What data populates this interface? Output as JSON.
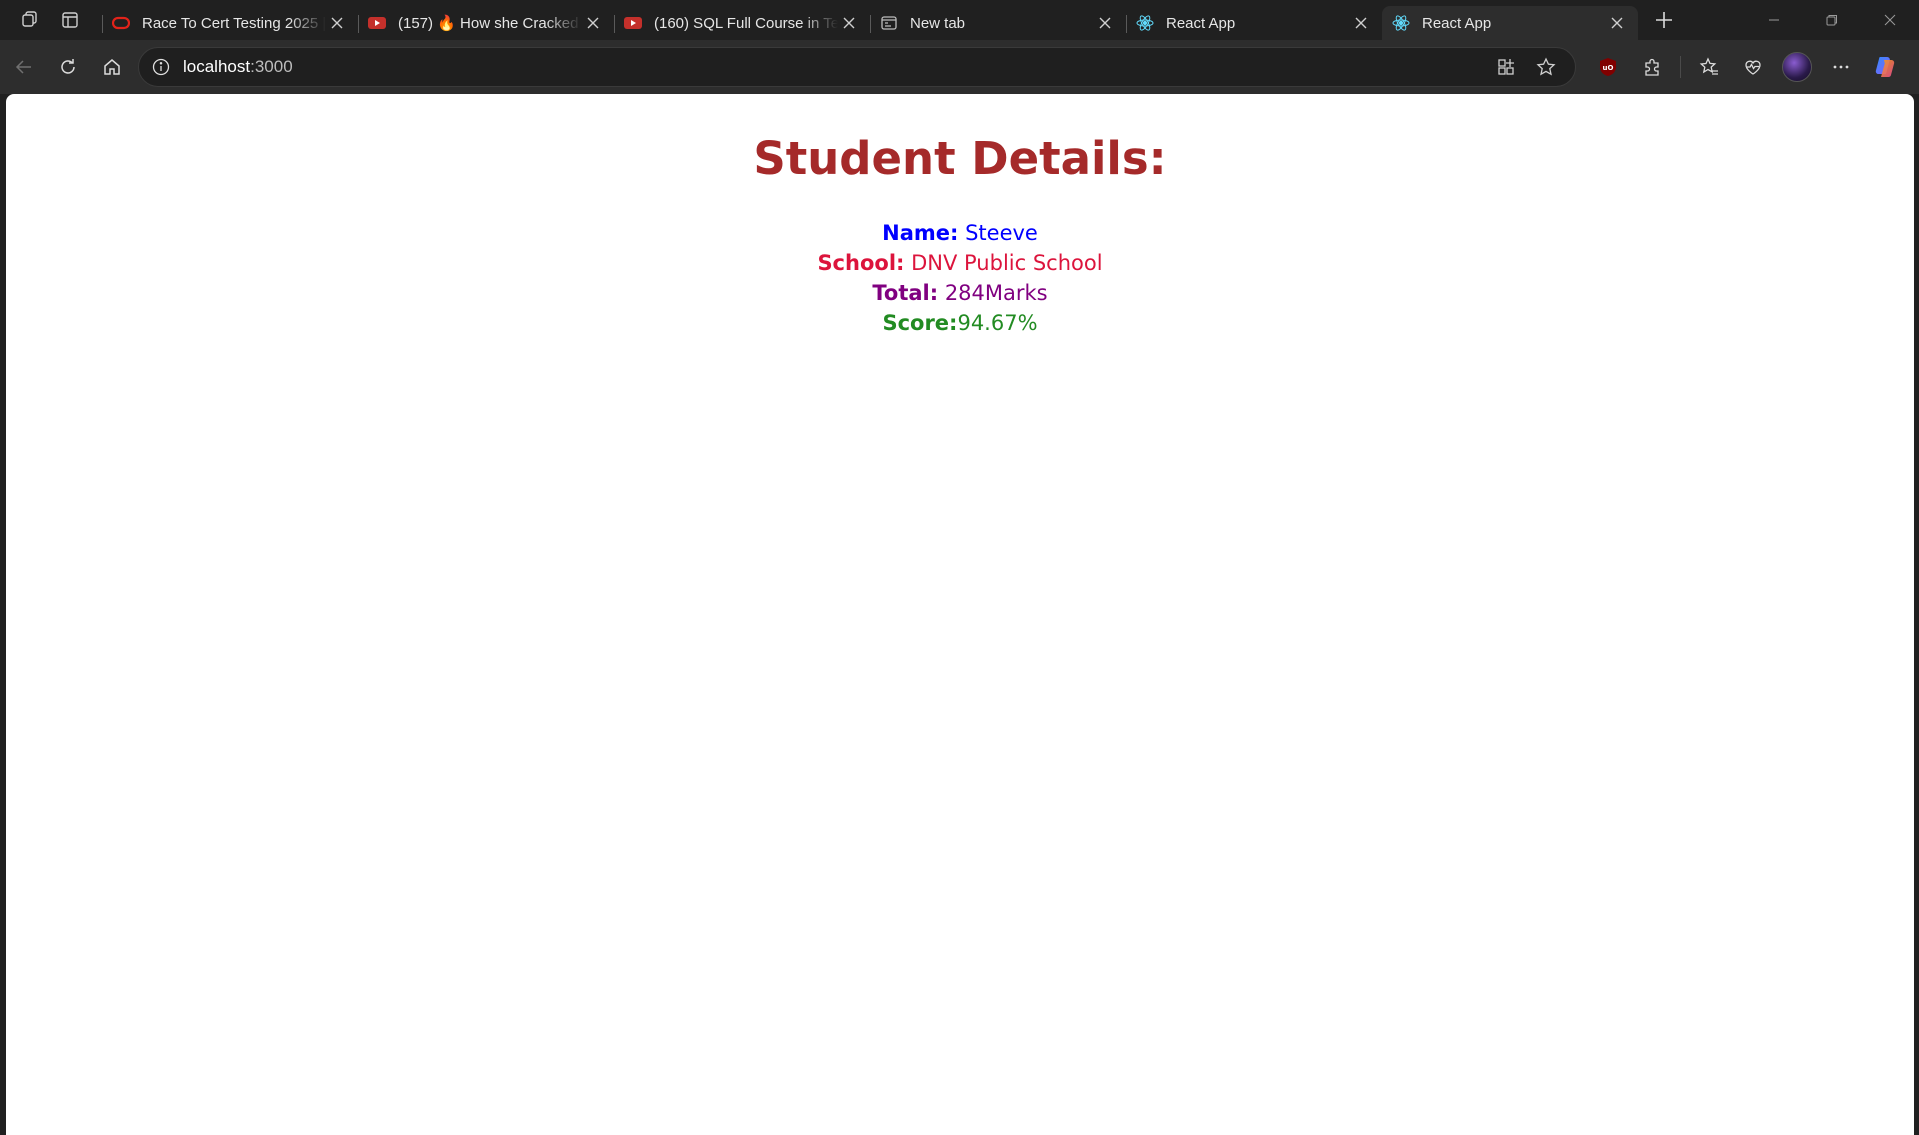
{
  "browser": {
    "tabs": [
      {
        "title": "Race To Cert Testing 2025 |",
        "favicon": "oracle-icon",
        "active": false
      },
      {
        "title": "(157) 🔥 How she Cracked",
        "favicon": "youtube-icon",
        "active": false
      },
      {
        "title": "(160) SQL Full Course in Tel",
        "favicon": "youtube-icon",
        "active": false
      },
      {
        "title": "New tab",
        "favicon": "newtab-icon",
        "active": false
      },
      {
        "title": "React App",
        "favicon": "react-icon",
        "active": false
      },
      {
        "title": "React App",
        "favicon": "react-icon",
        "active": true
      }
    ],
    "address": {
      "host": "localhost",
      "port": ":3000"
    },
    "colors": {
      "react": "#61dafb",
      "youtube": "#ff0033",
      "oracle": "#e2231a"
    }
  },
  "page": {
    "title": "Student Details:",
    "name": {
      "label": "Name:",
      "value": " Steeve",
      "color": "#0000ff"
    },
    "school": {
      "label": "School:",
      "value": " DNV Public School",
      "color": "#dc143c"
    },
    "total": {
      "label": "Total:",
      "value": " 284Marks",
      "color": "#800080"
    },
    "score": {
      "label": "Score:",
      "value": "94.67%",
      "color": "#228b22"
    }
  }
}
